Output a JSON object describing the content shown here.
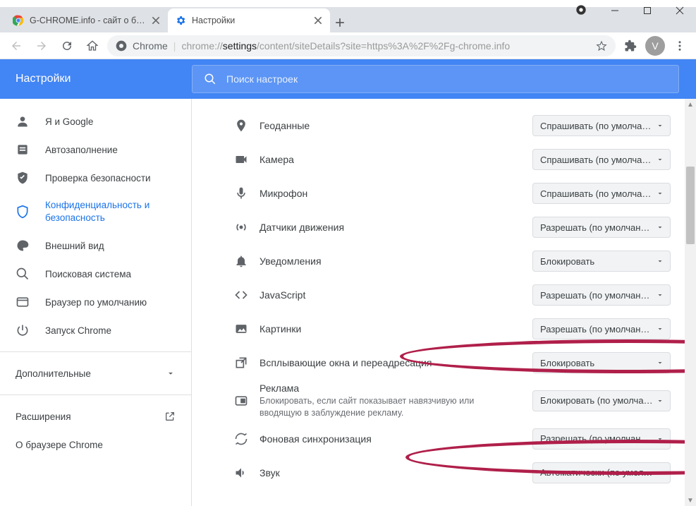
{
  "window": {
    "avatar_letter": "V"
  },
  "tabs": [
    {
      "title": "G-CHROME.info - сайт о браузере",
      "active": false
    },
    {
      "title": "Настройки",
      "active": true
    }
  ],
  "address": {
    "scheme_label": "Chrome",
    "url_prefix": "chrome://",
    "url_seg1": "settings",
    "url_rest": "/content/siteDetails?site=https%3A%2F%2Fg-chrome.info"
  },
  "bluebar": {
    "title": "Настройки"
  },
  "search": {
    "placeholder": "Поиск настроек"
  },
  "sidebar": {
    "items": [
      {
        "label": "Я и Google",
        "icon": "person"
      },
      {
        "label": "Автозаполнение",
        "icon": "autofill"
      },
      {
        "label": "Проверка безопасности",
        "icon": "shield-check"
      },
      {
        "label": "Конфиденциальность и безопасность",
        "icon": "shield",
        "active": true,
        "multiline": true
      },
      {
        "label": "Внешний вид",
        "icon": "palette"
      },
      {
        "label": "Поисковая система",
        "icon": "search"
      },
      {
        "label": "Браузер по умолчанию",
        "icon": "default-browser"
      },
      {
        "label": "Запуск Chrome",
        "icon": "power"
      }
    ],
    "advanced_label": "Дополнительные",
    "extensions_label": "Расширения",
    "about_label": "О браузере Chrome"
  },
  "permissions": [
    {
      "icon": "location",
      "label": "Геоданные",
      "value": "Спрашивать (по умолчанию"
    },
    {
      "icon": "camera",
      "label": "Камера",
      "value": "Спрашивать (по умолчанию"
    },
    {
      "icon": "mic",
      "label": "Микрофон",
      "value": "Спрашивать (по умолчанию"
    },
    {
      "icon": "motion",
      "label": "Датчики движения",
      "value": "Разрешать (по умолчанию)"
    },
    {
      "icon": "bell",
      "label": "Уведомления",
      "value": "Блокировать"
    },
    {
      "icon": "code",
      "label": "JavaScript",
      "value": "Разрешать (по умолчанию)"
    },
    {
      "icon": "image",
      "label": "Картинки",
      "value": "Разрешать (по умолчанию)"
    },
    {
      "icon": "popup",
      "label": "Всплывающие окна и переадресация",
      "value": "Блокировать"
    },
    {
      "icon": "ads",
      "label": "Реклама",
      "sub": "Блокировать, если сайт показывает навязчивую или вводящую в заблуждение рекламу.",
      "value": "Блокировать (по умолчанию"
    },
    {
      "icon": "sync",
      "label": "Фоновая синхронизация",
      "value": "Разрешать (по умолчанию)"
    },
    {
      "icon": "sound",
      "label": "Звук",
      "value": "Автоматически (по умолчан"
    }
  ]
}
